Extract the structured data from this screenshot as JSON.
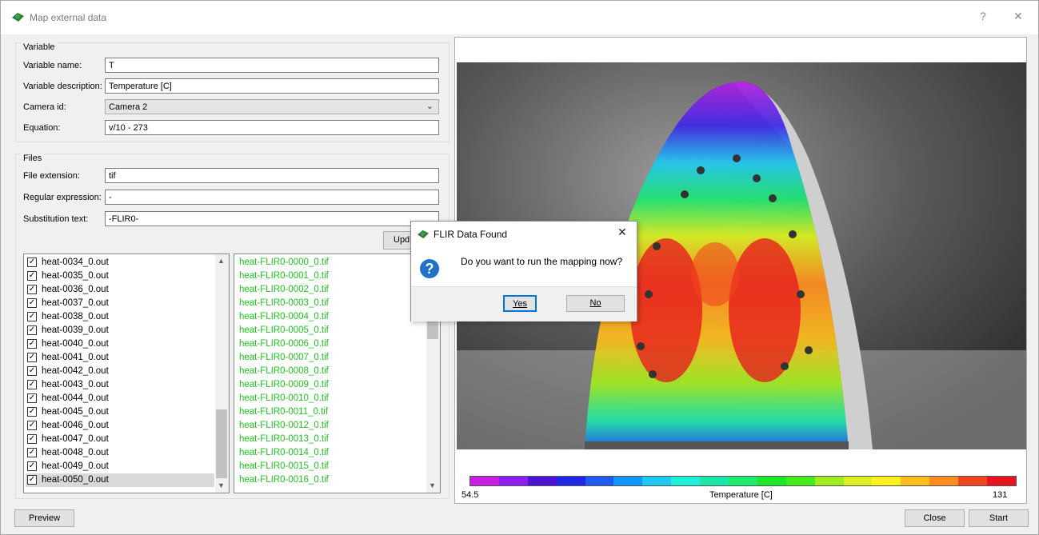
{
  "window": {
    "title": "Map external data",
    "help_glyph": "?",
    "close_glyph": "✕"
  },
  "variable": {
    "group_label": "Variable",
    "name_label": "Variable name:",
    "name_value": "T",
    "desc_label": "Variable description:",
    "desc_value": "Temperature [C]",
    "camera_label": "Camera id:",
    "camera_value": "Camera 2",
    "equation_label": "Equation:",
    "equation_value": "v/10 - 273"
  },
  "files": {
    "group_label": "Files",
    "ext_label": "File extension:",
    "ext_value": "tif",
    "regex_label": "Regular expression:",
    "regex_value": "-",
    "subst_label": "Substitution text:",
    "subst_value": "-FLIR0-",
    "update_label": "Upd"
  },
  "result_files": [
    "heat-0034_0.out",
    "heat-0035_0.out",
    "heat-0036_0.out",
    "heat-0037_0.out",
    "heat-0038_0.out",
    "heat-0039_0.out",
    "heat-0040_0.out",
    "heat-0041_0.out",
    "heat-0042_0.out",
    "heat-0043_0.out",
    "heat-0044_0.out",
    "heat-0045_0.out",
    "heat-0046_0.out",
    "heat-0047_0.out",
    "heat-0048_0.out",
    "heat-0049_0.out",
    "heat-0050_0.out"
  ],
  "result_files_checked": true,
  "selected_result_file": "heat-0050_0.out",
  "data_files": [
    "heat-FLIR0-0000_0.tif",
    "heat-FLIR0-0001_0.tif",
    "heat-FLIR0-0002_0.tif",
    "heat-FLIR0-0003_0.tif",
    "heat-FLIR0-0004_0.tif",
    "heat-FLIR0-0005_0.tif",
    "heat-FLIR0-0006_0.tif",
    "heat-FLIR0-0007_0.tif",
    "heat-FLIR0-0008_0.tif",
    "heat-FLIR0-0009_0.tif",
    "heat-FLIR0-0010_0.tif",
    "heat-FLIR0-0011_0.tif",
    "heat-FLIR0-0012_0.tif",
    "heat-FLIR0-0013_0.tif",
    "heat-FLIR0-0014_0.tif",
    "heat-FLIR0-0015_0.tif",
    "heat-FLIR0-0016_0.tif"
  ],
  "data_file_color": "#1dc41d",
  "colorbar": {
    "min_label": "54.5",
    "max_label": "131",
    "title": "Temperature [C]",
    "colors": [
      "#c81ee1",
      "#8c1ef0",
      "#4b14d2",
      "#1e28e6",
      "#1e5af0",
      "#1496ff",
      "#1ec8f0",
      "#1ef0dc",
      "#1ee6aa",
      "#1eeb6e",
      "#1ee628",
      "#46eb1e",
      "#a0eb1e",
      "#dcf01e",
      "#fff01e",
      "#ffbe1e",
      "#ff8c1e",
      "#f0461e",
      "#e6141e"
    ]
  },
  "buttons": {
    "preview": "Preview",
    "close": "Close",
    "start": "Start"
  },
  "dialog": {
    "title": "FLIR Data Found",
    "close_glyph": "✕",
    "message": "Do you want to run the mapping now?",
    "yes": "Yes",
    "no": "No",
    "icon_glyph": "?"
  }
}
